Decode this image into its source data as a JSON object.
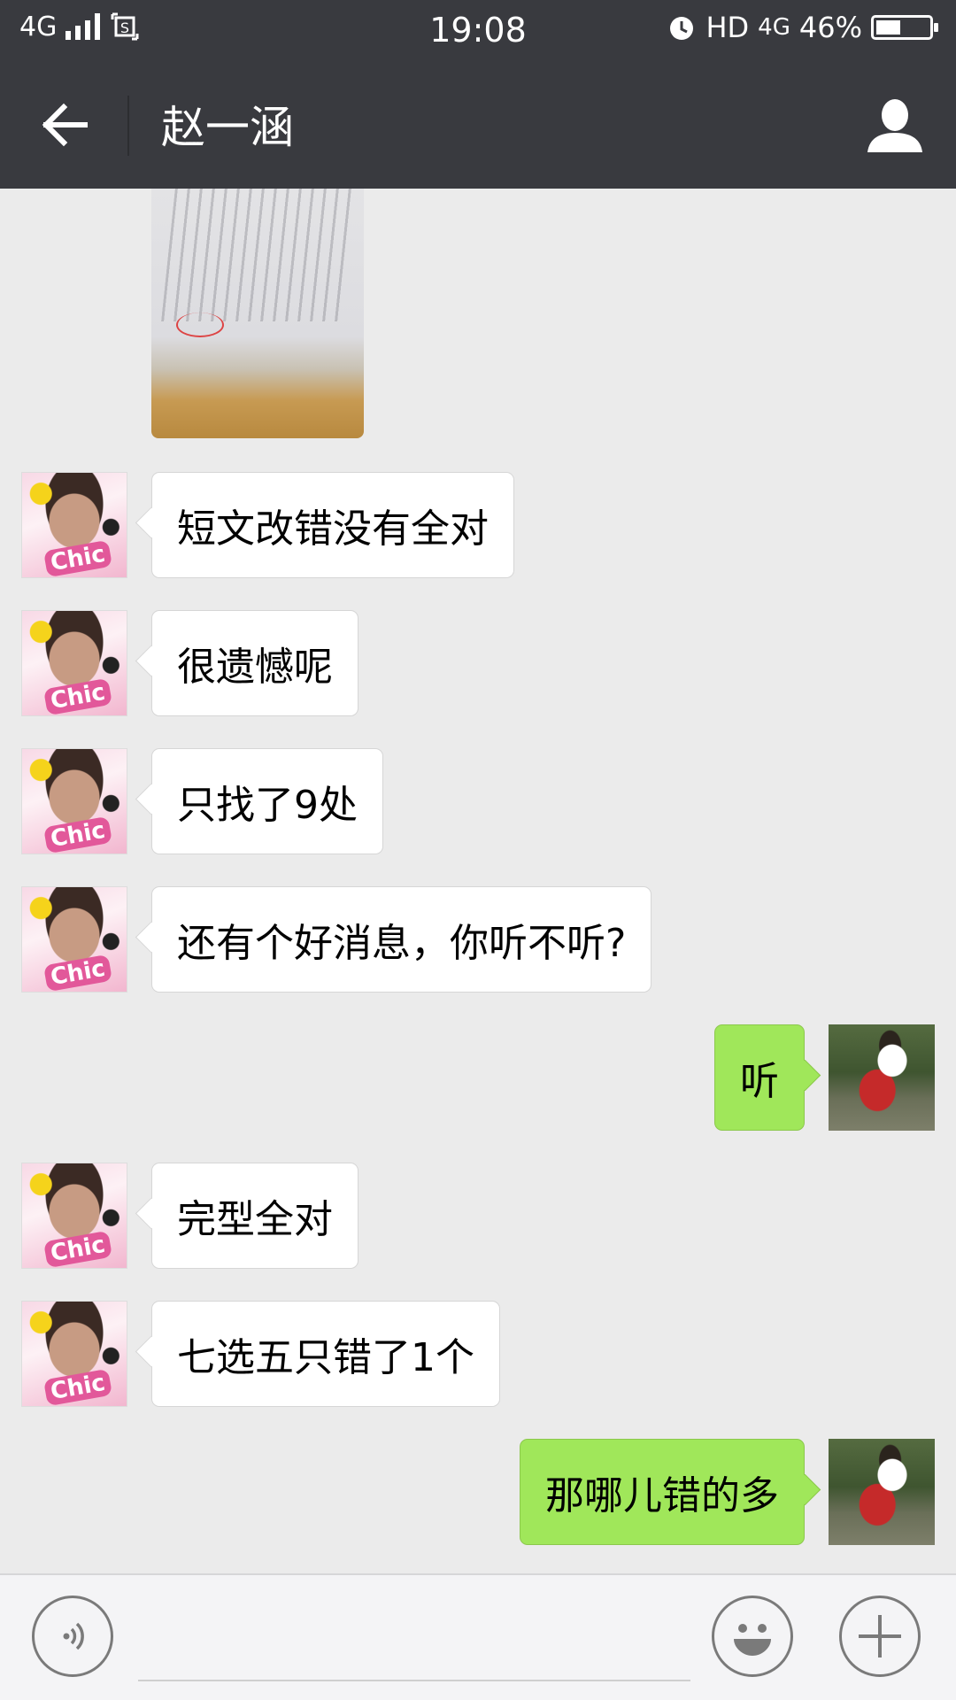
{
  "status_bar": {
    "network": "4G",
    "time": "19:08",
    "hd": "HD",
    "network_right": "4G",
    "battery_percent": "46%",
    "battery_level": 0.46,
    "icons": [
      "signal-icon",
      "screenshot-icon",
      "alarm-icon",
      "battery-icon"
    ]
  },
  "header": {
    "title": "赵一涵",
    "back_icon": "arrow-left-icon",
    "profile_icon": "person-icon"
  },
  "messages": [
    {
      "side": "left",
      "text": "短文改错没有全对"
    },
    {
      "side": "left",
      "text": "很遗憾呢"
    },
    {
      "side": "left",
      "text": "只找了9处"
    },
    {
      "side": "left",
      "text": "还有个好消息，你听不听?"
    },
    {
      "side": "right",
      "text": "听"
    },
    {
      "side": "left",
      "text": "完型全对"
    },
    {
      "side": "left",
      "text": "七选五只错了1个"
    },
    {
      "side": "right",
      "text": "那哪儿错的多"
    }
  ],
  "avatars": {
    "friend_badge_text": "Chic"
  },
  "input_bar": {
    "voice_icon": "voice-icon",
    "emoji_icon": "smiley-icon",
    "plus_icon": "plus-icon",
    "placeholder": ""
  },
  "colors": {
    "header_bg": "#393a3f",
    "chat_bg": "#ebebeb",
    "sent_bubble": "#a0e75a",
    "received_bubble": "#ffffff"
  }
}
